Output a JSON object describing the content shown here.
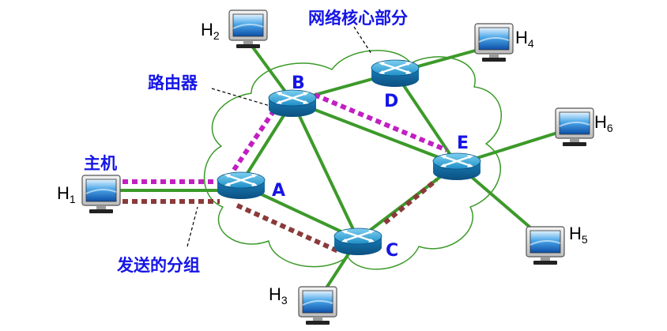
{
  "labels": {
    "core_network": "网络核心部分",
    "router": "路由器",
    "host": "主机",
    "packet": "发送的分组"
  },
  "routers": [
    {
      "id": "A",
      "label": "A"
    },
    {
      "id": "B",
      "label": "B"
    },
    {
      "id": "C",
      "label": "C"
    },
    {
      "id": "D",
      "label": "D"
    },
    {
      "id": "E",
      "label": "E"
    }
  ],
  "hosts": [
    {
      "id": "H1",
      "label": "H",
      "sub": "1"
    },
    {
      "id": "H2",
      "label": "H",
      "sub": "2"
    },
    {
      "id": "H3",
      "label": "H",
      "sub": "3"
    },
    {
      "id": "H4",
      "label": "H",
      "sub": "4"
    },
    {
      "id": "H5",
      "label": "H",
      "sub": "5"
    },
    {
      "id": "H6",
      "label": "H",
      "sub": "6"
    }
  ],
  "colors": {
    "link": "#3c9a2a",
    "cloud": "#3c9a2a",
    "label_text": "#1515e6",
    "path_magenta": "#c21fc2",
    "path_brown": "#8b3a3a"
  }
}
